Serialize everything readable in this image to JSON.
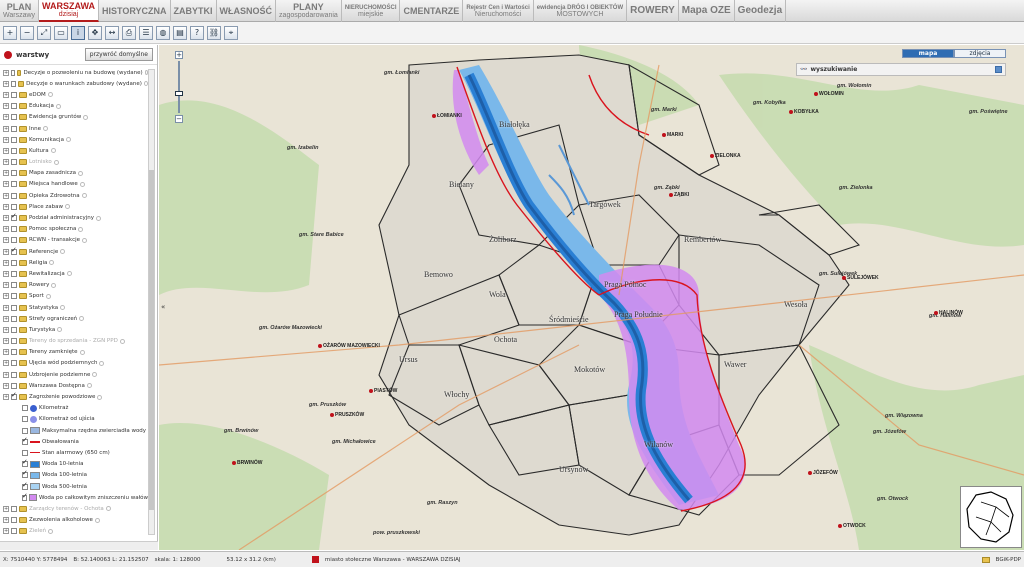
{
  "tabs": [
    {
      "l1": "PLAN",
      "l2": "Warszawy",
      "active": false
    },
    {
      "l1": "WARSZAWA",
      "l2": "dzisiaj",
      "active": true
    },
    {
      "l1": "HISTORYCZNA",
      "l2": "",
      "active": false
    },
    {
      "l1": "ZABYTKI",
      "l2": "",
      "active": false
    },
    {
      "l1": "WŁASNOŚĆ",
      "l2": "",
      "active": false
    },
    {
      "l1": "PLANY",
      "l2": "zagospodarowania",
      "active": false
    },
    {
      "l1": "NIERUCHOMOŚCI",
      "l2": "miejskie",
      "active": false
    },
    {
      "l1": "CMENTARZE",
      "l2": "",
      "active": false
    },
    {
      "l1": "Rejestr Cen i Wartości",
      "l2": "Nieruchomości",
      "active": false
    },
    {
      "l1": "ewidencja DRÓG I OBIEKTÓW",
      "l2": "MOSTOWYCH",
      "active": false
    },
    {
      "l1": "ROWERY",
      "l2": "",
      "active": false
    },
    {
      "l1": "Mapa OZE",
      "l2": "",
      "active": false
    },
    {
      "l1": "Geodezja",
      "l2": "",
      "active": false
    }
  ],
  "toolbar": {
    "tools": [
      "zoom-in-icon",
      "zoom-out-icon",
      "zoom-extent-icon",
      "zoom-window-icon",
      "info-icon",
      "pan-icon",
      "measure-icon",
      "print-icon",
      "layers-icon",
      "globe-icon",
      "save-icon",
      "help-icon",
      "link-icon",
      "coordinates-icon"
    ],
    "glyphs": [
      "+",
      "−",
      "⤢",
      "▭",
      "i",
      "✥",
      "↔",
      "⎙",
      "☰",
      "◍",
      "▤",
      "?",
      "⛓",
      "⌖"
    ]
  },
  "panel": {
    "title": "warstwy",
    "reset_label": "przywróć domyślne",
    "layers": [
      {
        "name": "Decyzje o pozwoleniu na budowę (wydane)",
        "checked": false,
        "dim": false
      },
      {
        "name": "Decyzje o warunkach zabudowy (wydane)",
        "checked": false,
        "dim": false
      },
      {
        "name": "eDOM",
        "checked": false,
        "dim": false
      },
      {
        "name": "Edukacja",
        "checked": false,
        "dim": false
      },
      {
        "name": "Ewidencja gruntów",
        "checked": false,
        "dim": false
      },
      {
        "name": "Inne",
        "checked": false,
        "dim": false
      },
      {
        "name": "Komunikacja",
        "checked": false,
        "dim": false
      },
      {
        "name": "Kultura",
        "checked": false,
        "dim": false
      },
      {
        "name": "Lotnisko",
        "checked": false,
        "dim": true
      },
      {
        "name": "Mapa zasadnicza",
        "checked": false,
        "dim": false
      },
      {
        "name": "Miejsca handlowe",
        "checked": false,
        "dim": false
      },
      {
        "name": "Opieka Zdrowotna",
        "checked": false,
        "dim": false
      },
      {
        "name": "Place zabaw",
        "checked": false,
        "dim": false
      },
      {
        "name": "Podział administracyjny",
        "checked": true,
        "dim": false
      },
      {
        "name": "Pomoc społeczna",
        "checked": false,
        "dim": false
      },
      {
        "name": "RCWN - transakcje",
        "checked": false,
        "dim": false
      },
      {
        "name": "Referencje",
        "checked": true,
        "dim": false
      },
      {
        "name": "Religia",
        "checked": false,
        "dim": false
      },
      {
        "name": "Rewitalizacja",
        "checked": false,
        "dim": false
      },
      {
        "name": "Rowery",
        "checked": false,
        "dim": false
      },
      {
        "name": "Sport",
        "checked": false,
        "dim": false
      },
      {
        "name": "Statystyka",
        "checked": false,
        "dim": false
      },
      {
        "name": "Strefy ograniczeń",
        "checked": false,
        "dim": false
      },
      {
        "name": "Turystyka",
        "checked": false,
        "dim": false
      },
      {
        "name": "Tereny do sprzedania - ZGN PPD",
        "checked": false,
        "dim": true
      },
      {
        "name": "Tereny zamknięte",
        "checked": false,
        "dim": false
      },
      {
        "name": "Ujęcia wód podziemnych",
        "checked": false,
        "dim": false
      },
      {
        "name": "Uzbrojenie podziemne",
        "checked": false,
        "dim": false
      },
      {
        "name": "Warszawa Dostępna",
        "checked": false,
        "dim": false
      },
      {
        "name": "Zagrożenie powodziowe",
        "checked": true,
        "dim": false
      }
    ],
    "sublayers": [
      {
        "name": "Kilometraż",
        "checked": false,
        "color": "#3a5fcf",
        "kind": "circle"
      },
      {
        "name": "Kilometraż od ujścia",
        "checked": false,
        "color": "#8a90e8",
        "kind": "circle"
      },
      {
        "name": "Maksymalna rzędna zwierciadła wody",
        "checked": false,
        "color": "#9ab7e0",
        "kind": "grid"
      },
      {
        "name": "Obwałowania",
        "checked": true,
        "color": "#d9141e",
        "kind": "line"
      },
      {
        "name": "Stan alarmowy (650 cm)",
        "checked": false,
        "color": "#d9141e",
        "kind": "thin"
      },
      {
        "name": "Woda 10-letnia",
        "checked": true,
        "color": "#2a7fd4",
        "kind": "fill"
      },
      {
        "name": "Woda 100-letnia",
        "checked": true,
        "color": "#7ab8ea",
        "kind": "fill"
      },
      {
        "name": "Woda 500-letnia",
        "checked": true,
        "color": "#a9d3f2",
        "kind": "fill"
      },
      {
        "name": "Woda po całkowitym zniszczeniu wałów",
        "checked": true,
        "color": "#d28af0",
        "kind": "fill"
      }
    ],
    "after": [
      {
        "name": "Zarządcy terenów - Ochota",
        "checked": false,
        "dim": true
      },
      {
        "name": "Zezwolenia alkoholowe",
        "checked": false,
        "dim": false
      },
      {
        "name": "Zieleń",
        "checked": false,
        "dim": true
      }
    ]
  },
  "map": {
    "type_buttons": {
      "map": "mapa",
      "photo": "zdjęcia"
    },
    "search_label": "wyszukiwanie",
    "districts": [
      "Białołęka",
      "Bielany",
      "Targówek",
      "Żoliborz",
      "Rembertów",
      "Bemowo",
      "Praga Północ",
      "Wola",
      "Praga Południe",
      "Wesoła",
      "Śródmieście",
      "Ochota",
      "Ursus",
      "Mokotów",
      "Wawer",
      "Włochy",
      "Wilanów",
      "Ursynów"
    ],
    "gminas": [
      "gm. Łomianki",
      "gm. Marki",
      "gm. Kobyłka",
      "gm. Wołomin",
      "gm. Poświętne",
      "gm. Izabelin",
      "gm. Ząbki",
      "gm. Zielonka",
      "gm. Stare Babice",
      "gm. Sulejówek",
      "gm. Ożarów Mazowiecki",
      "gm. Halinów",
      "gm. Pruszków",
      "gm. Raszyn",
      "gm. Michałowice",
      "gm. Brwinów",
      "gm. Józefów",
      "gm. Otwock",
      "gm. Wiązowna",
      "pow. pruszkowski"
    ],
    "towns": [
      "ŁOMIANKI",
      "MARKI",
      "KOBYŁKA",
      "WOŁOMIN",
      "ZIELONKA",
      "ZĄBKI",
      "SULEJÓWEK",
      "HALINÓW",
      "OŻARÓW MAZOWIECKI",
      "PIASTÓW",
      "PRUSZKÓW",
      "BRWINÓW",
      "JÓZEFÓW",
      "OTWOCK"
    ]
  },
  "status": {
    "coords": "X: 7510440 Y: 5778494",
    "latlon": "B: 52.140063 L: 21.152507",
    "scale": "skala: 1: 128000",
    "extent": "53.12 x 31.2 (km)",
    "source": "miasto stołeczne Warszawa - WARSZAWA DZISIAJ",
    "credit": "BGiK-PDP"
  }
}
